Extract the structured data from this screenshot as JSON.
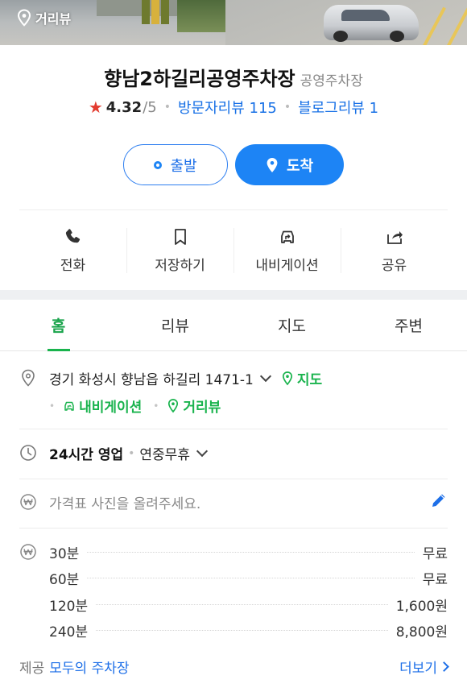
{
  "photo": {
    "streetview_label": "거리뷰"
  },
  "place": {
    "name": "향남2하길리공영주차장",
    "category": "공영주차장",
    "rating": "4.32",
    "rating_max": "/5",
    "visitor_reviews": "방문자리뷰 115",
    "blog_reviews": "블로그리뷰 1"
  },
  "route": {
    "depart_label": "출발",
    "arrive_label": "도착"
  },
  "actions": [
    {
      "label": "전화",
      "icon": "phone-icon"
    },
    {
      "label": "저장하기",
      "icon": "bookmark-icon"
    },
    {
      "label": "내비게이션",
      "icon": "car-navigation-icon"
    },
    {
      "label": "공유",
      "icon": "share-icon"
    }
  ],
  "tabs": [
    {
      "label": "홈",
      "active": true
    },
    {
      "label": "리뷰",
      "active": false
    },
    {
      "label": "지도",
      "active": false
    },
    {
      "label": "주변",
      "active": false
    }
  ],
  "address": {
    "text": "경기 화성시 향남읍 하길리 1471-1",
    "map_link": "지도",
    "navigation_link": "내비게이션",
    "streetview_link": "거리뷰"
  },
  "hours": {
    "status": "24시간 영업",
    "holiday": "연중무휴"
  },
  "price_hint": "가격표 사진을 올려주세요.",
  "fees": [
    {
      "duration": "30분",
      "price": "무료"
    },
    {
      "duration": "60분",
      "price": "무료"
    },
    {
      "duration": "120분",
      "price": "1,600원"
    },
    {
      "duration": "240분",
      "price": "8,800원"
    }
  ],
  "provider": {
    "prefix": "제공",
    "name": "모두의 주차장",
    "more_label": "더보기"
  },
  "colors": {
    "green": "#19b34d",
    "blue": "#1d84f5",
    "star": "#e33b2f"
  }
}
